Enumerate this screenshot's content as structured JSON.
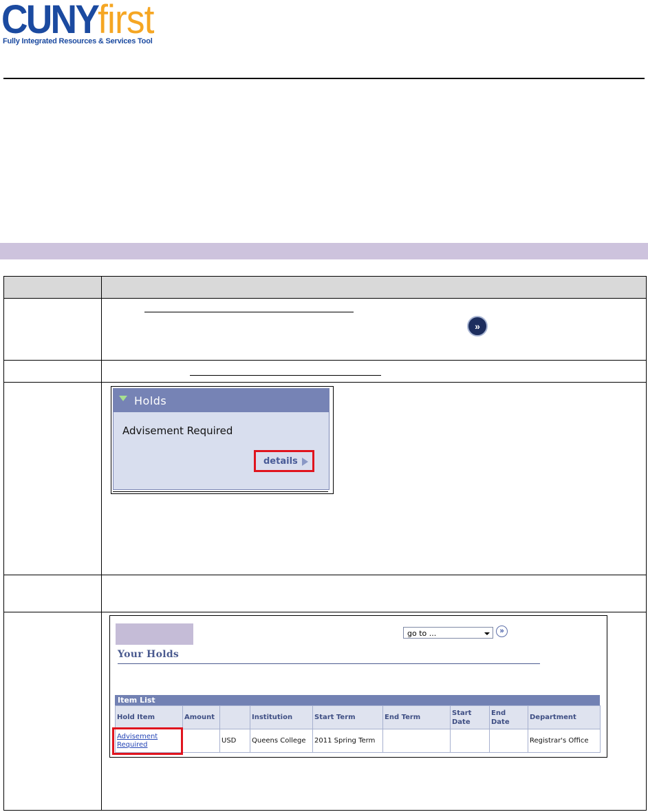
{
  "logo": {
    "brand_main": "CUNY",
    "brand_accent": "first",
    "tagline": "Fully Integrated Resources & Services Tool",
    "brand_color": "#1b4aa0",
    "accent_color": "#f5a623"
  },
  "section_bar_color": "#cdc3dd",
  "holds_widget": {
    "title": "Holds",
    "item": "Advisement Required",
    "details_link": "details",
    "header_color": "#7683b5",
    "body_color": "#d8deee"
  },
  "go_icon": {
    "glyph": "»",
    "name": "fast-forward-icon"
  },
  "your_holds": {
    "goto_value": "go to ...",
    "goto_button_glyph": "»",
    "page_title": "Your Holds",
    "item_list_label": "Item List",
    "columns": [
      "Hold Item",
      "Amount",
      "",
      "Institution",
      "Start Term",
      "End Term",
      "Start Date",
      "End Date",
      "Department"
    ],
    "rows": [
      {
        "hold_item": "Advisement Required",
        "amount": "",
        "currency": "USD",
        "institution": "Queens College",
        "start_term": "2011 Spring Term",
        "end_term": "",
        "start_date": "",
        "end_date": "",
        "department": "Registrar's Office"
      }
    ]
  }
}
